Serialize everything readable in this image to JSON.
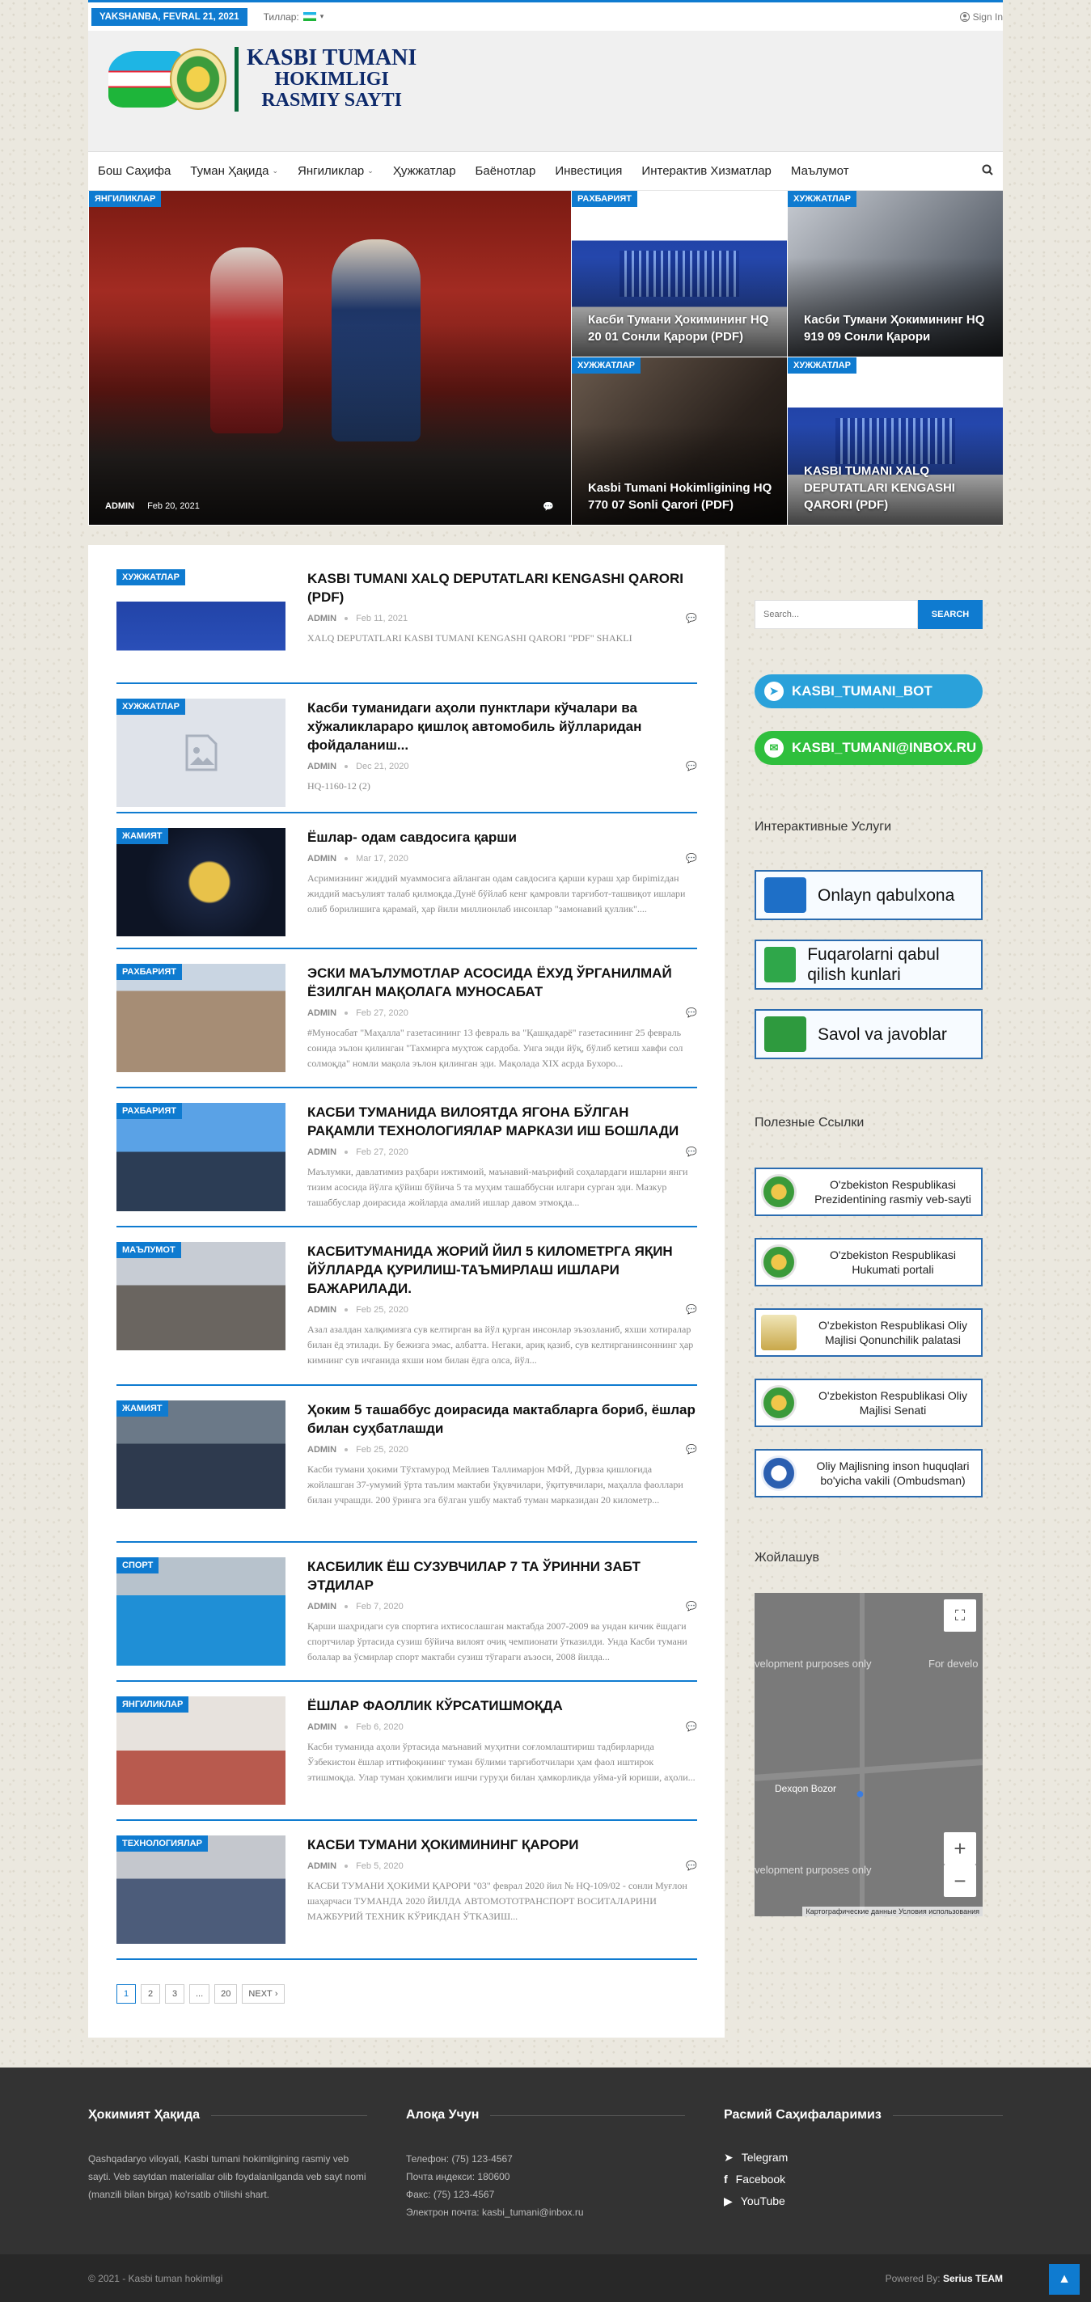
{
  "topbar": {
    "date": "YAKSHANBA, FEVRAL 21, 2021",
    "lang_label": "Тиллар:",
    "signin": "Sign In"
  },
  "logo": {
    "line1": "KASBI TUMANI",
    "line2": "HOKIMLIGI",
    "line3": "RASMIY SAYTI"
  },
  "nav": {
    "items": [
      "Бош Саҳифа",
      "Туман Ҳақида",
      "Янгиликлар",
      "Ҳужжатлар",
      "Баёнотлар",
      "Инвестиция",
      "Интерактив Хизматлар",
      "Маълумот"
    ]
  },
  "hero": {
    "big": {
      "cat": "ЯНГИЛИКЛАР",
      "author": "ADMIN",
      "date": "Feb 20, 2021"
    },
    "tiles": [
      {
        "cat": "РАХБАРИЯТ",
        "title": "Касби Тумани Ҳокимининг HQ 20 01 Сонли Қарори (PDF)"
      },
      {
        "cat": "ХУЖЖАТЛАР",
        "title": "Касби Тумани Ҳокимининг HQ 919 09 Сонли Қарори"
      },
      {
        "cat": "ХУЖЖАТЛАР",
        "title": "Kasbi Tumani Hokimligining HQ 770 07 Sonli Qarori (PDF)"
      },
      {
        "cat": "ХУЖЖАТЛАР",
        "title": "KASBI TUMANI XALQ DEPUTATLARI KENGASHI QARORI (PDF)"
      }
    ]
  },
  "posts": [
    {
      "cat": "ХУЖЖАТЛАР",
      "title": "KASBI TUMANI XALQ DEPUTATLARI KENGASHI QARORI (PDF)",
      "author": "ADMIN",
      "date": "Feb 11, 2021",
      "excerpt": "XALQ DEPUTATLARI KASBI TUMANI KENGASHI QARORI \"PDF\" SHAKLI"
    },
    {
      "cat": "ХУЖЖАТЛАР",
      "title": "Касби туманидаги аҳоли пунктлари кўчалари ва хўжаликлараро қишлоқ автомобиль йўлларидан фойдаланиш...",
      "author": "ADMIN",
      "date": "Dec 21, 2020",
      "excerpt": "HQ-1160-12 (2)"
    },
    {
      "cat": "ЖАМИЯТ",
      "title": "Ёшлар- одам савдосига қарши",
      "author": "ADMIN",
      "date": "Mar 17, 2020",
      "excerpt": "Асримизнинг жиддий муаммосига айланган одам савдосига қарши кураш ҳар бирimizдан жиддий масъулият талаб қилмоқда.Дунё бўйлаб кенг қамровли тарғибот-ташвиқот ишлари олиб борилишига қарамай, ҳар йили миллионлаб инсонлар \"замонавий қуллик\"...."
    },
    {
      "cat": "РАХБАРИЯТ",
      "title": "ЭСКИ МАЪЛУМОТЛАР АСОСИДА ЁХУД ЎРГАНИЛМАЙ ЁЗИЛГАН МАҚОЛАГА МУНОСАБАТ",
      "author": "ADMIN",
      "date": "Feb 27, 2020",
      "excerpt": "#Муносабат \"Маҳалла\" газетасининг 13 февраль ва \"Қашқадарё\" газетасининг 25 февраль сонида эълон қилинган \"Тахмирга муҳтож сардоба. Унга энди йўқ, бўлиб кетиш хавфи сол солмоқда\" номли мақола эълон қилинган эди. Мақолада XIX асрда Бухоро..."
    },
    {
      "cat": "РАХБАРИЯТ",
      "title": "КАСБИ ТУМАНИДА ВИЛОЯТДА ЯГОНА БЎЛГАН РАҚАМЛИ ТЕХНОЛОГИЯЛАР МАРКАЗИ ИШ БОШЛАДИ",
      "author": "ADMIN",
      "date": "Feb 27, 2020",
      "excerpt": "Маълумки, давлатимиз раҳбари ижтимоий, маънавий-маърифий соҳалардаги ишларни янги тизим асосида йўлга қўйиш бўйича 5 та муҳим ташаббусни илгари сурган эди. Мазкур ташаббуслар доирасида жойларда амалий ишлар давом этмоқда..."
    },
    {
      "cat": "МАЪЛУМОТ",
      "title": "КАСБИТУМАНИДА ЖОРИЙ ЙИЛ  5 КИЛОМЕТРГА ЯҚИН ЙЎЛЛАРДА ҚУРИЛИШ-ТАЪМИРЛАШ ИШЛАРИ БАЖАРИЛАДИ.",
      "author": "ADMIN",
      "date": "Feb 25, 2020",
      "excerpt": "Азал азалдан халқимизга сув келтирган ва йўл қурган инсонлар эъзозланиб, яхши хотиралар билан ёд этилади. Бу бежизга эмас, албатта. Негаки, ариқ қазиб, сув келтирганинсоннинг ҳар кимнинг сув ичганида яхши ном билан ёдга олса, йўл..."
    },
    {
      "cat": "ЖАМИЯТ",
      "title": "Ҳоким 5 ташаббус доирасида мактабларга бориб, ёшлар билан суҳбатлашди",
      "author": "ADMIN",
      "date": "Feb 25, 2020",
      "excerpt": "Касби тумани ҳокими Тўхтамурод Мейлиев Таллимарjон МФЙ, Дурвза қишлоғида жойлашган 37-умумий ўрта таълим мактаби ўқувчилари, ўқитувчилари, маҳалла фаоллари билан учрашди. 200 ўринга эга бўлган ушбу мактаб туман марказидан 20 километр..."
    },
    {
      "cat": "СПОРТ",
      "title": "КАСБИЛИК ЁШ СУЗУВЧИЛАР 7 ТА ЎРИННИ ЗАБТ ЭТДИЛАР",
      "author": "ADMIN",
      "date": "Feb 7, 2020",
      "excerpt": "Қарши шаҳридаги сув спортига ихтисослашган мактабда  2007-2009 ва ундан кичик ёшдаги спортчилар ўртасида сузиш бўйича вилоят очиқ чемпионати ўтказилди. Унда Касби тумани болалар ва ўсмирлар спорт мактаби сузиш тўгараги аъзоси, 2008 йилда..."
    },
    {
      "cat": "ЯНГИЛИКЛАР",
      "title": "ЁШЛАР ФАОЛЛИК КЎРСАТИШМОҚДА",
      "author": "ADMIN",
      "date": "Feb 6, 2020",
      "excerpt": "Касби туманида аҳоли ўртасида маънавий муҳитни соғломлаштириш тадбирларида Ўзбекистон ёшлар иттифоқининг туман бўлими тарғиботчилари ҳам фаол иштирок этишмоқда. Улар туман ҳокимлиги ишчи гуруҳи билан ҳамкорликда уйма-уй юриши, аҳоли..."
    },
    {
      "cat": "ТЕХНОЛОГИЯЛАР",
      "title": "КАСБИ ТУМАНИ ҲОКИМИНИНГ ҚАРОРИ",
      "author": "ADMIN",
      "date": "Feb 5, 2020",
      "excerpt": "КАСБИ ТУМАНИ ҲОКИМИ ҚАРОРИ \"03\" феврал  2020 йил          № HQ-109/02 - сонли           Муғлон шаҳарчаси  ТУМАНДА 2020 ЙИЛДА АВТОМОТОТРАНСПОРТ ВОСИТАЛАРИНИ МАЖБУРИЙ  ТЕХНИК КЎРИКДАН ЎТКАЗИШ..."
    }
  ],
  "pager": {
    "pages": [
      "1",
      "2",
      "3",
      "...",
      "20"
    ],
    "next": "NEXT"
  },
  "sidebar": {
    "search_placeholder": "Search...",
    "search_button": "SEARCH",
    "telegram": "KASBI_TUMANI_BOT",
    "email": "KASBI_TUMANI@INBOX.RU",
    "services_title": "Интерактивные Услуги",
    "services": [
      "Onlayn qabulxona",
      "Fuqarolarni qabul qilish kunlari",
      "Savol va javoblar"
    ],
    "links_title": "Полезные Ссылки",
    "links": [
      "O'zbekiston Respublikasi Prezidentining rasmiy veb-sayti",
      "O'zbekiston Respublikasi Hukumati portali",
      "O'zbekiston Respublikasi Oliy Majlisi Qonunchilik palatasi",
      "O'zbekiston Respublikasi Oliy Majlisi Senati",
      "Oliy Majlisning inson huquqlari bo'yicha vakili (Ombudsman)"
    ],
    "map_title": "Жойлашув",
    "map_watermark": "velopment purposes only",
    "map_watermark2": "For develo",
    "map_place": "Dexqon Bozor",
    "map_attr": "Картографические данные   Условия использования"
  },
  "footer": {
    "col1_title": "Ҳокимият Ҳақида",
    "col1_text": "Qashqadaryo viloyati, Kasbi tumani hokimligining rasmiy veb sayti. Veb saytdan materiallar olib foydalanilganda veb sayt nomi (manzili bilan birga) ko'rsatib o'tilishi shart.",
    "col2_title": "Алоқа Учун",
    "col2_lines": [
      "Телефон: (75) 123-4567",
      "Почта индекси: 180600",
      "Факс: (75) 123-4567",
      "Электрон почта: kasbi_tumani@inbox.ru"
    ],
    "col3_title": "Расмий Саҳифаларимиз",
    "socials": [
      "Telegram",
      "Facebook",
      "YouTube"
    ]
  },
  "copyright": {
    "left": "© 2021 - Kasbi tuman hokimligi",
    "right_prefix": "Powered By:",
    "right_brand": "Serius TEAM"
  }
}
